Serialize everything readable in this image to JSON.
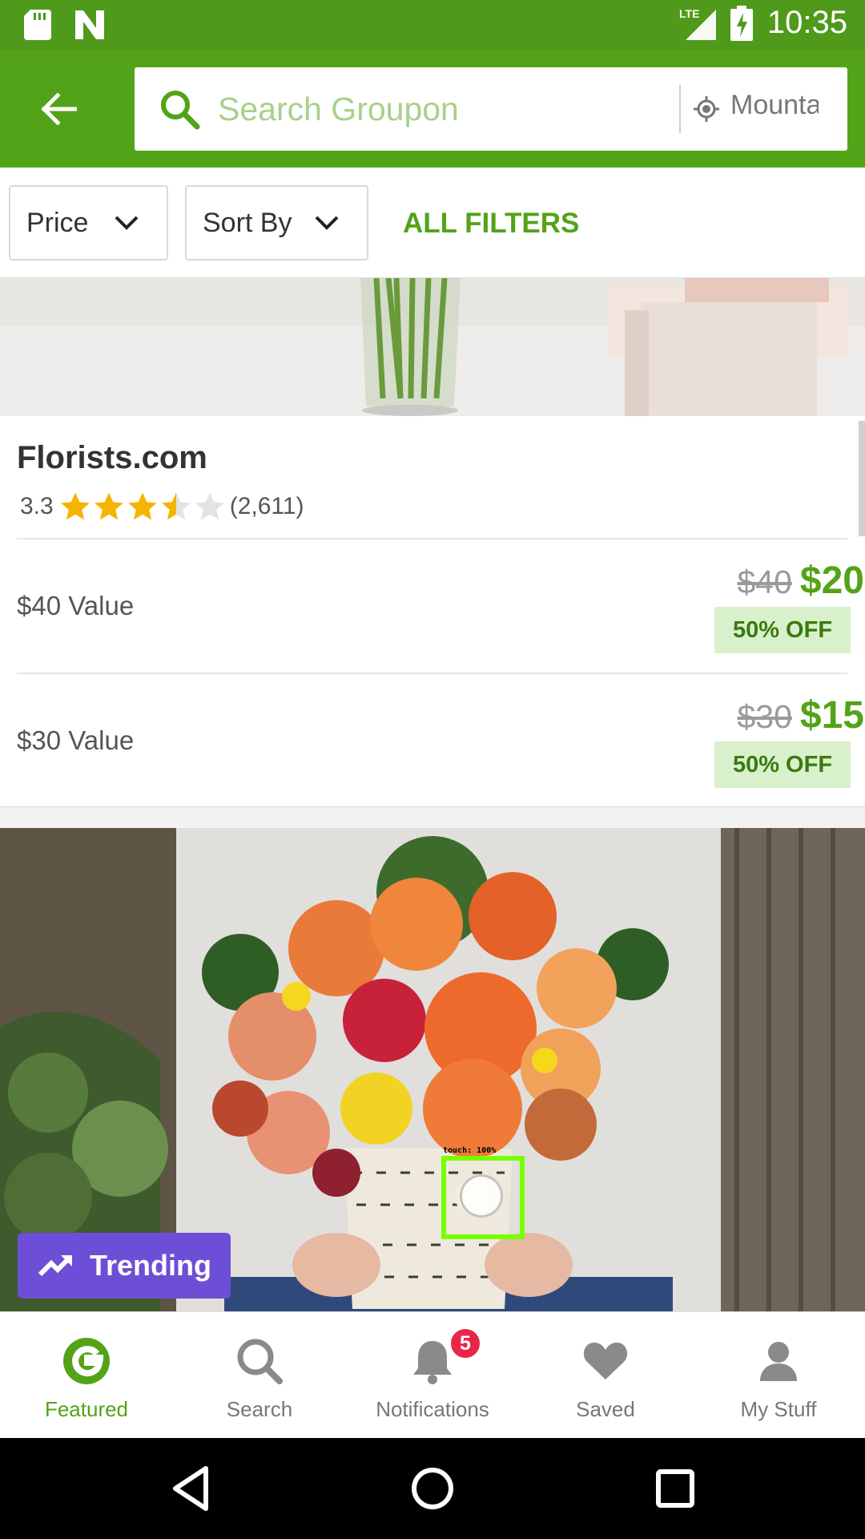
{
  "status_bar": {
    "time": "10:35",
    "network": "LTE"
  },
  "search": {
    "placeholder": "Search Groupon",
    "location": "Mountain"
  },
  "filters": {
    "price_label": "Price",
    "sort_label": "Sort By",
    "all_filters_label": "ALL FILTERS"
  },
  "deal": {
    "merchant": "Florists.com",
    "rating": "3.3",
    "rating_stars": 3.5,
    "review_count": "(2,611)",
    "options": [
      {
        "label": "$40 Value",
        "old_price": "$40",
        "new_price": "$20",
        "discount": "50% OFF"
      },
      {
        "label": "$30 Value",
        "old_price": "$30",
        "new_price": "$15",
        "discount": "50% OFF"
      }
    ]
  },
  "trending": {
    "label": "Trending"
  },
  "touch_overlay": {
    "label": "touch: 100%"
  },
  "bottom_nav": {
    "items": [
      {
        "label": "Featured",
        "icon": "groupon-g-icon"
      },
      {
        "label": "Search",
        "icon": "search-icon"
      },
      {
        "label": "Notifications",
        "icon": "bell-icon",
        "badge": "5"
      },
      {
        "label": "Saved",
        "icon": "heart-icon"
      },
      {
        "label": "My Stuff",
        "icon": "person-icon"
      }
    ]
  },
  "colors": {
    "brand_green": "#53a318",
    "status_green": "#4f9a1a",
    "trending_purple": "#6c4fd6",
    "badge_red": "#e8264a",
    "star_gold": "#f5b400"
  }
}
